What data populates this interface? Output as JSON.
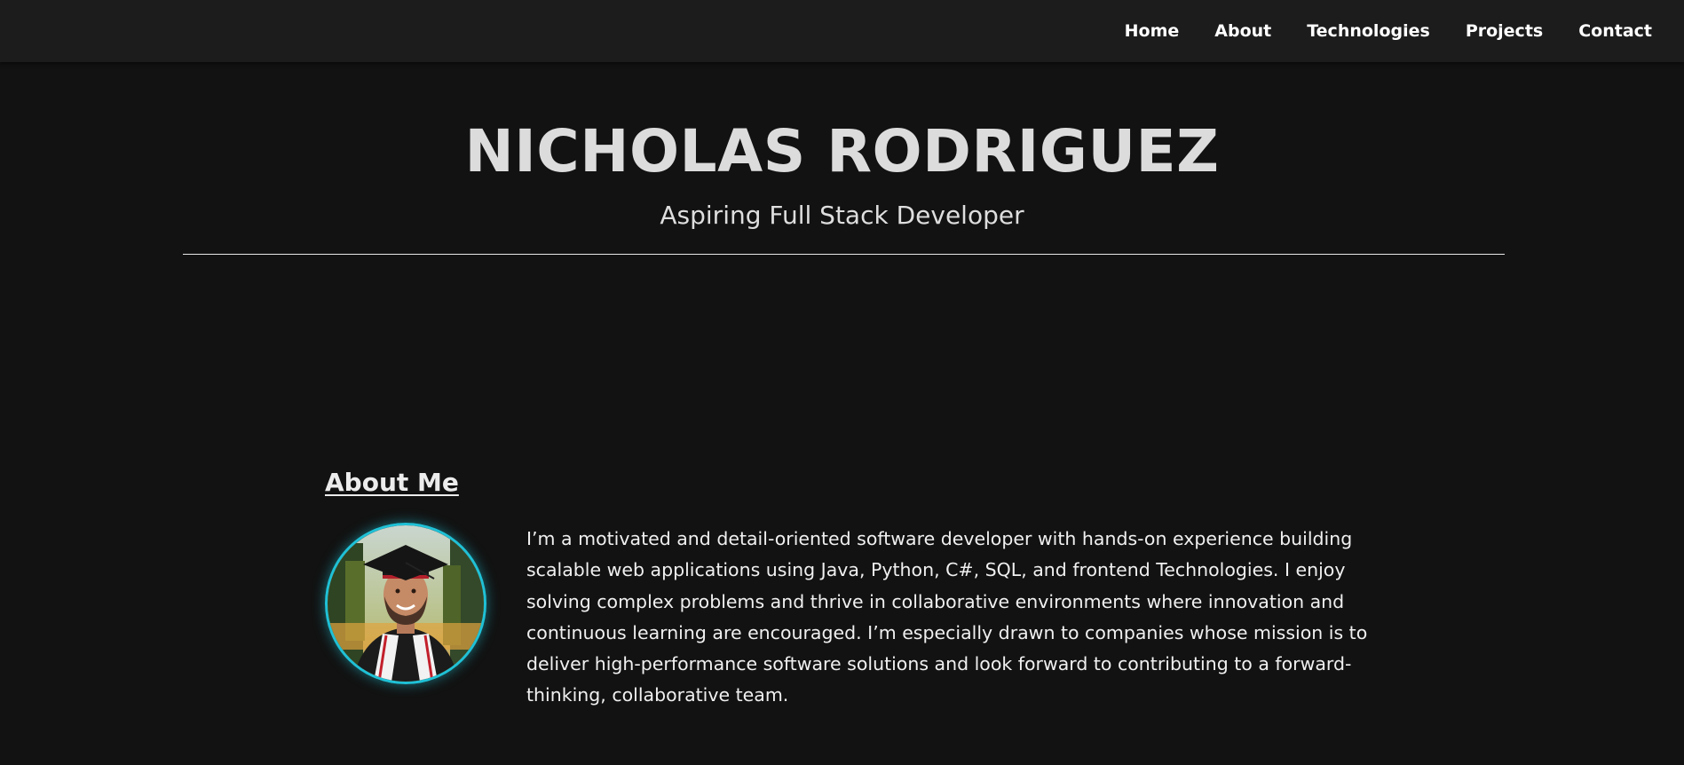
{
  "nav": {
    "items": [
      {
        "label": "Home"
      },
      {
        "label": "About"
      },
      {
        "label": "Technologies"
      },
      {
        "label": "Projects"
      },
      {
        "label": "Contact"
      }
    ]
  },
  "hero": {
    "name": "NICHOLAS RODRIGUEZ",
    "subtitle": "Aspiring Full Stack Developer"
  },
  "about": {
    "heading": "About Me",
    "avatar_icon": "graduation-portrait-photo",
    "paragraph": "I’m a motivated and detail-oriented software developer with hands-on experience building scalable web applications using Java, Python, C#, SQL, and frontend Technologies. I enjoy solving complex problems and thrive in collaborative environments where innovation and continuous learning are encouraged. I’m especially drawn to companies whose mission is to deliver high-performance software solutions and look forward to contributing to a forward-thinking, collaborative team."
  },
  "colors": {
    "background": "#121212",
    "navbar": "#1c1c1c",
    "avatar_border": "#1fc1d6"
  }
}
